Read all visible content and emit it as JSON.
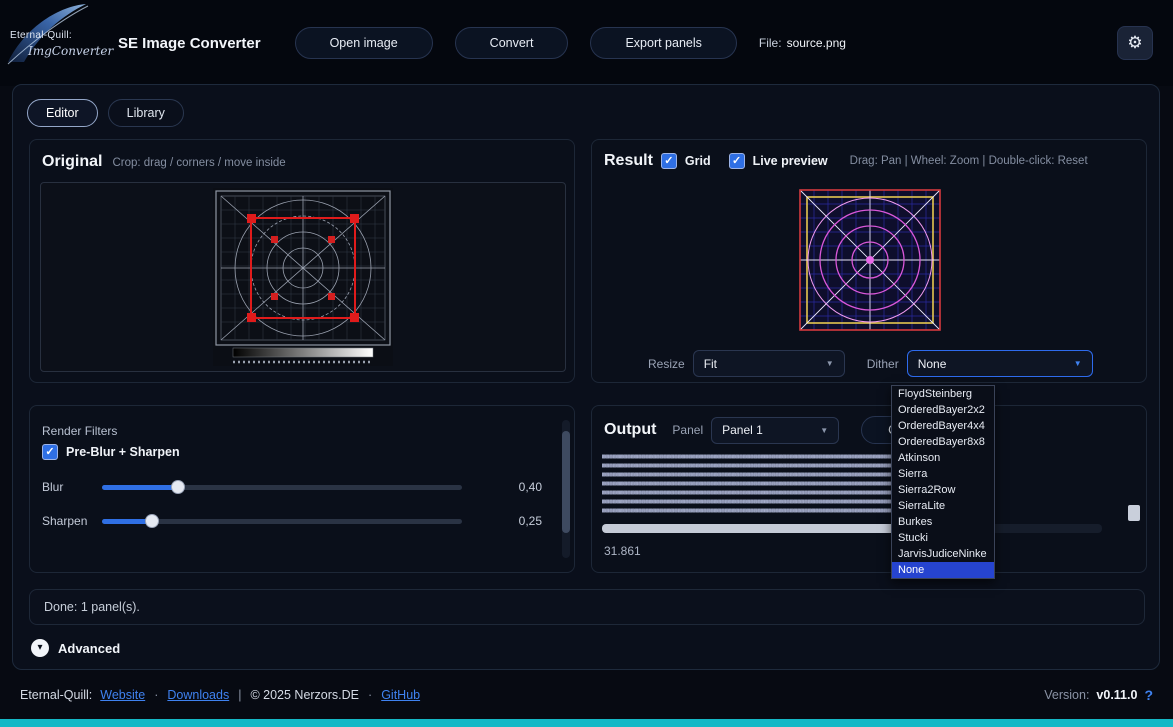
{
  "topbar": {
    "logo": {
      "line1": "Eternal-Quill:",
      "line2": "ImgConverter"
    },
    "title": "SE Image Converter",
    "buttons": {
      "open_image": "Open image",
      "convert": "Convert",
      "export_panels": "Export panels"
    },
    "file_label": "File:",
    "file_name": "source.png",
    "gear_icon": "⚙"
  },
  "tabs": {
    "editor": "Editor",
    "library": "Library"
  },
  "original": {
    "title": "Original",
    "hint": "Crop: drag / corners / move inside"
  },
  "result": {
    "title": "Result",
    "grid_label": "Grid",
    "live_preview_label": "Live preview",
    "hint": "Drag: Pan | Wheel: Zoom | Double-click: Reset",
    "resize_label": "Resize",
    "resize_value": "Fit",
    "dither_label": "Dither",
    "dither_value": "None"
  },
  "dither_options": [
    "FloydSteinberg",
    "OrderedBayer2x2",
    "OrderedBayer4x4",
    "OrderedBayer8x8",
    "Atkinson",
    "Sierra",
    "Sierra2Row",
    "SierraLite",
    "Burkes",
    "Stucki",
    "JarvisJudiceNinke",
    "None"
  ],
  "dither_selected": "None",
  "filters": {
    "title": "Render Filters",
    "pre_blur_sharpen_label": "Pre-Blur + Sharpen",
    "blur_label": "Blur",
    "blur_value": "0,40",
    "sharpen_label": "Sharpen",
    "sharpen_value": "0,25"
  },
  "output": {
    "title": "Output",
    "panel_label": "Panel",
    "panel_value": "Panel 1",
    "copy_label": "Copy",
    "char_count": "31.861",
    "preview": {
      "char": "▩",
      "cols": 90,
      "rows": 7
    }
  },
  "status": {
    "text": "Done: 1 panel(s)."
  },
  "advanced": {
    "label": "Advanced",
    "chevron": "▾"
  },
  "footer": {
    "brand": "Eternal-Quill:",
    "website": "Website",
    "dot1": "·",
    "downloads": "Downloads",
    "pipe": "|",
    "copyright": "© 2025 Nerzors.DE",
    "dot2": "·",
    "github": "GitHub",
    "version_label": "Version:",
    "version_value": "v0.11.0",
    "help_icon": "?"
  },
  "colors": {
    "accent": "#2f6fe4",
    "highlight": "#2644cf",
    "strip": "#14b8c6"
  }
}
